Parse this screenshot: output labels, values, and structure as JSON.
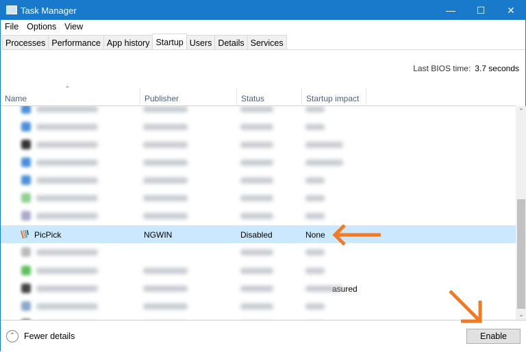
{
  "window": {
    "title": "Task Manager",
    "minimize_icon": "minimize",
    "maximize_icon": "maximize",
    "close_icon": "close"
  },
  "menu": [
    "File",
    "Options",
    "View"
  ],
  "tabs": [
    "Processes",
    "Performance",
    "App history",
    "Startup",
    "Users",
    "Details",
    "Services"
  ],
  "active_tab": "Startup",
  "bios": {
    "label": "Last BIOS time:",
    "value": "3.7 seconds"
  },
  "columns": [
    "Name",
    "Publisher",
    "Status",
    "Startup impact"
  ],
  "selected_row": {
    "name": "PicPick",
    "publisher": "NGWIN",
    "status": "Disabled",
    "impact": "None"
  },
  "partial_text": "asured",
  "footer": {
    "fewer_details": "Fewer details",
    "enable": "Enable"
  },
  "colors": {
    "accent": "#1979ca",
    "selection": "#cce8ff",
    "annotation_arrow": "#f47920"
  }
}
